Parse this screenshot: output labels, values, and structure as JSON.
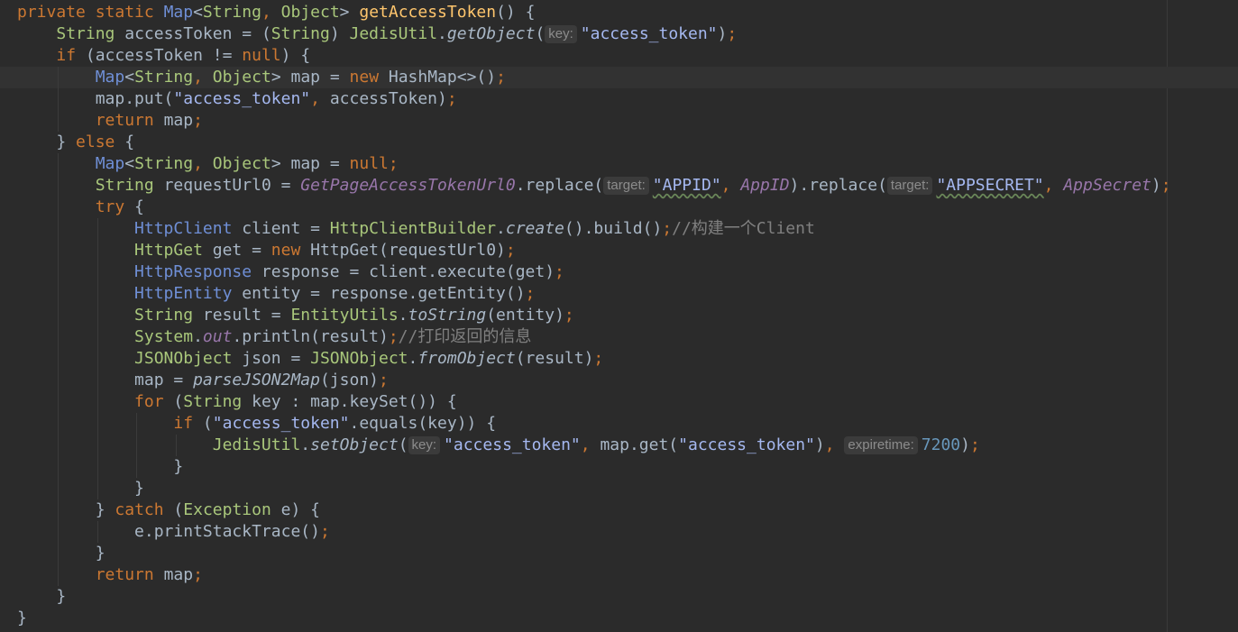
{
  "editor": {
    "colors": {
      "background": "#2b2b2b",
      "current_line": "#323232",
      "keyword": "#cc7832",
      "identifier": "#a9b7c6",
      "type": "#a9c77b",
      "string": "#a5b8f0",
      "number": "#6897bb",
      "method_decl": "#ffc66d",
      "field_static": "#9876aa",
      "comment": "#808080",
      "interface_type": "#6f8fd6",
      "hint_text": "#8c8c8c",
      "hint_bg": "#3b3b3b"
    },
    "current_line_index": 3,
    "lines": [
      {
        "indent": 0,
        "tokens": [
          {
            "t": "private static ",
            "c": "kw"
          },
          {
            "t": "Map",
            "c": "blue"
          },
          {
            "t": "<",
            "c": "id"
          },
          {
            "t": "String",
            "c": "type"
          },
          {
            "t": ", ",
            "c": "pun"
          },
          {
            "t": "Object",
            "c": "type"
          },
          {
            "t": "> ",
            "c": "id"
          },
          {
            "t": "getAccessToken",
            "c": "method"
          },
          {
            "t": "() {",
            "c": "id"
          }
        ]
      },
      {
        "indent": 1,
        "tokens": [
          {
            "t": "String",
            "c": "type"
          },
          {
            "t": " accessToken = (",
            "c": "id"
          },
          {
            "t": "String",
            "c": "type"
          },
          {
            "t": ") ",
            "c": "id"
          },
          {
            "t": "JedisUtil",
            "c": "type"
          },
          {
            "t": ".",
            "c": "id"
          },
          {
            "t": "getObject",
            "c": "static"
          },
          {
            "t": "(",
            "c": "id"
          },
          {
            "t": "key:",
            "c": "hint"
          },
          {
            "t": "\"access_token\"",
            "c": "str"
          },
          {
            "t": ")",
            "c": "id"
          },
          {
            "t": ";",
            "c": "pun"
          }
        ]
      },
      {
        "indent": 1,
        "tokens": [
          {
            "t": "if",
            "c": "kw"
          },
          {
            "t": " (accessToken != ",
            "c": "id"
          },
          {
            "t": "null",
            "c": "kw"
          },
          {
            "t": ") {",
            "c": "id"
          }
        ]
      },
      {
        "indent": 2,
        "tokens": [
          {
            "t": "Map",
            "c": "blue"
          },
          {
            "t": "<",
            "c": "id"
          },
          {
            "t": "String",
            "c": "type"
          },
          {
            "t": ", ",
            "c": "pun"
          },
          {
            "t": "Object",
            "c": "type"
          },
          {
            "t": "> map = ",
            "c": "id"
          },
          {
            "t": "new ",
            "c": "kw"
          },
          {
            "t": "HashMap<>()",
            "c": "id"
          },
          {
            "t": ";",
            "c": "pun"
          }
        ]
      },
      {
        "indent": 2,
        "tokens": [
          {
            "t": "map.put(",
            "c": "id"
          },
          {
            "t": "\"access_token\"",
            "c": "str"
          },
          {
            "t": ", ",
            "c": "pun"
          },
          {
            "t": "accessToken)",
            "c": "id"
          },
          {
            "t": ";",
            "c": "pun"
          }
        ]
      },
      {
        "indent": 2,
        "tokens": [
          {
            "t": "return ",
            "c": "kw"
          },
          {
            "t": "map",
            "c": "id"
          },
          {
            "t": ";",
            "c": "pun"
          }
        ]
      },
      {
        "indent": 1,
        "tokens": [
          {
            "t": "} ",
            "c": "id"
          },
          {
            "t": "else",
            "c": "kw"
          },
          {
            "t": " {",
            "c": "id"
          }
        ]
      },
      {
        "indent": 2,
        "tokens": [
          {
            "t": "Map",
            "c": "blue"
          },
          {
            "t": "<",
            "c": "id"
          },
          {
            "t": "String",
            "c": "type"
          },
          {
            "t": ", ",
            "c": "pun"
          },
          {
            "t": "Object",
            "c": "type"
          },
          {
            "t": "> map = ",
            "c": "id"
          },
          {
            "t": "null",
            "c": "kw"
          },
          {
            "t": ";",
            "c": "pun"
          }
        ]
      },
      {
        "indent": 2,
        "tokens": [
          {
            "t": "String",
            "c": "type"
          },
          {
            "t": " requestUrl0 = ",
            "c": "id"
          },
          {
            "t": "GetPageAccessTokenUrl0",
            "c": "field"
          },
          {
            "t": ".replace(",
            "c": "id"
          },
          {
            "t": "target:",
            "c": "hint"
          },
          {
            "t": "\"APPID\"",
            "c": "strsq"
          },
          {
            "t": ", ",
            "c": "pun"
          },
          {
            "t": "AppID",
            "c": "field"
          },
          {
            "t": ").replace(",
            "c": "id"
          },
          {
            "t": "target:",
            "c": "hint"
          },
          {
            "t": "\"APPSECRET\"",
            "c": "strsq"
          },
          {
            "t": ", ",
            "c": "pun"
          },
          {
            "t": "AppSecret",
            "c": "field"
          },
          {
            "t": ")",
            "c": "id"
          },
          {
            "t": ";",
            "c": "pun"
          }
        ]
      },
      {
        "indent": 2,
        "tokens": [
          {
            "t": "try",
            "c": "kw"
          },
          {
            "t": " {",
            "c": "id"
          }
        ]
      },
      {
        "indent": 3,
        "tokens": [
          {
            "t": "HttpClient",
            "c": "blue"
          },
          {
            "t": " client = ",
            "c": "id"
          },
          {
            "t": "HttpClientBuilder",
            "c": "type"
          },
          {
            "t": ".",
            "c": "id"
          },
          {
            "t": "create",
            "c": "static"
          },
          {
            "t": "().build()",
            "c": "id"
          },
          {
            "t": ";",
            "c": "pun"
          },
          {
            "t": "//构建一个Client",
            "c": "cmt"
          }
        ]
      },
      {
        "indent": 3,
        "tokens": [
          {
            "t": "HttpGet",
            "c": "type"
          },
          {
            "t": " get = ",
            "c": "id"
          },
          {
            "t": "new ",
            "c": "kw"
          },
          {
            "t": "HttpGet(requestUrl0)",
            "c": "id"
          },
          {
            "t": ";",
            "c": "pun"
          }
        ]
      },
      {
        "indent": 3,
        "tokens": [
          {
            "t": "HttpResponse",
            "c": "blue"
          },
          {
            "t": " response = client.execute(get)",
            "c": "id"
          },
          {
            "t": ";",
            "c": "pun"
          }
        ]
      },
      {
        "indent": 3,
        "tokens": [
          {
            "t": "HttpEntity",
            "c": "blue"
          },
          {
            "t": " entity = response.getEntity()",
            "c": "id"
          },
          {
            "t": ";",
            "c": "pun"
          }
        ]
      },
      {
        "indent": 3,
        "tokens": [
          {
            "t": "String",
            "c": "type"
          },
          {
            "t": " result = ",
            "c": "id"
          },
          {
            "t": "EntityUtils",
            "c": "type"
          },
          {
            "t": ".",
            "c": "id"
          },
          {
            "t": "toString",
            "c": "static"
          },
          {
            "t": "(entity)",
            "c": "id"
          },
          {
            "t": ";",
            "c": "pun"
          }
        ]
      },
      {
        "indent": 3,
        "tokens": [
          {
            "t": "System",
            "c": "type"
          },
          {
            "t": ".",
            "c": "id"
          },
          {
            "t": "out",
            "c": "field"
          },
          {
            "t": ".println(result)",
            "c": "id"
          },
          {
            "t": ";",
            "c": "pun"
          },
          {
            "t": "//打印返回的信息",
            "c": "cmt"
          }
        ]
      },
      {
        "indent": 3,
        "tokens": [
          {
            "t": "JSONObject",
            "c": "type"
          },
          {
            "t": " json = ",
            "c": "id"
          },
          {
            "t": "JSONObject",
            "c": "type"
          },
          {
            "t": ".",
            "c": "id"
          },
          {
            "t": "fromObject",
            "c": "static"
          },
          {
            "t": "(result)",
            "c": "id"
          },
          {
            "t": ";",
            "c": "pun"
          }
        ]
      },
      {
        "indent": 3,
        "tokens": [
          {
            "t": "map = ",
            "c": "id"
          },
          {
            "t": "parseJSON2Map",
            "c": "static"
          },
          {
            "t": "(json)",
            "c": "id"
          },
          {
            "t": ";",
            "c": "pun"
          }
        ]
      },
      {
        "indent": 3,
        "tokens": [
          {
            "t": "for",
            "c": "kw"
          },
          {
            "t": " (",
            "c": "id"
          },
          {
            "t": "String",
            "c": "type"
          },
          {
            "t": " key : map.keySet()) {",
            "c": "id"
          }
        ]
      },
      {
        "indent": 4,
        "tokens": [
          {
            "t": "if",
            "c": "kw"
          },
          {
            "t": " (",
            "c": "id"
          },
          {
            "t": "\"access_token\"",
            "c": "str"
          },
          {
            "t": ".equals(key)) {",
            "c": "id"
          }
        ]
      },
      {
        "indent": 5,
        "tokens": [
          {
            "t": "JedisUtil",
            "c": "type"
          },
          {
            "t": ".",
            "c": "id"
          },
          {
            "t": "setObject",
            "c": "static"
          },
          {
            "t": "(",
            "c": "id"
          },
          {
            "t": "key:",
            "c": "hint"
          },
          {
            "t": "\"access_token\"",
            "c": "str"
          },
          {
            "t": ", ",
            "c": "pun"
          },
          {
            "t": "map.get(",
            "c": "id"
          },
          {
            "t": "\"access_token\"",
            "c": "str"
          },
          {
            "t": ")",
            "c": "id"
          },
          {
            "t": ", ",
            "c": "pun"
          },
          {
            "t": "expiretime:",
            "c": "hint"
          },
          {
            "t": "7200",
            "c": "num"
          },
          {
            "t": ")",
            "c": "id"
          },
          {
            "t": ";",
            "c": "pun"
          }
        ]
      },
      {
        "indent": 4,
        "tokens": [
          {
            "t": "}",
            "c": "id"
          }
        ]
      },
      {
        "indent": 3,
        "tokens": [
          {
            "t": "}",
            "c": "id"
          }
        ]
      },
      {
        "indent": 2,
        "tokens": [
          {
            "t": "} ",
            "c": "id"
          },
          {
            "t": "catch",
            "c": "kw"
          },
          {
            "t": " (",
            "c": "id"
          },
          {
            "t": "Exception",
            "c": "type"
          },
          {
            "t": " e) {",
            "c": "id"
          }
        ]
      },
      {
        "indent": 3,
        "tokens": [
          {
            "t": "e.printStackTrace()",
            "c": "id"
          },
          {
            "t": ";",
            "c": "pun"
          }
        ]
      },
      {
        "indent": 2,
        "tokens": [
          {
            "t": "}",
            "c": "id"
          }
        ]
      },
      {
        "indent": 2,
        "tokens": [
          {
            "t": "return ",
            "c": "kw"
          },
          {
            "t": "map",
            "c": "id"
          },
          {
            "t": ";",
            "c": "pun"
          }
        ]
      },
      {
        "indent": 1,
        "tokens": [
          {
            "t": "}",
            "c": "id"
          }
        ]
      },
      {
        "indent": 0,
        "tokens": [
          {
            "t": "}",
            "c": "id"
          }
        ]
      }
    ]
  }
}
